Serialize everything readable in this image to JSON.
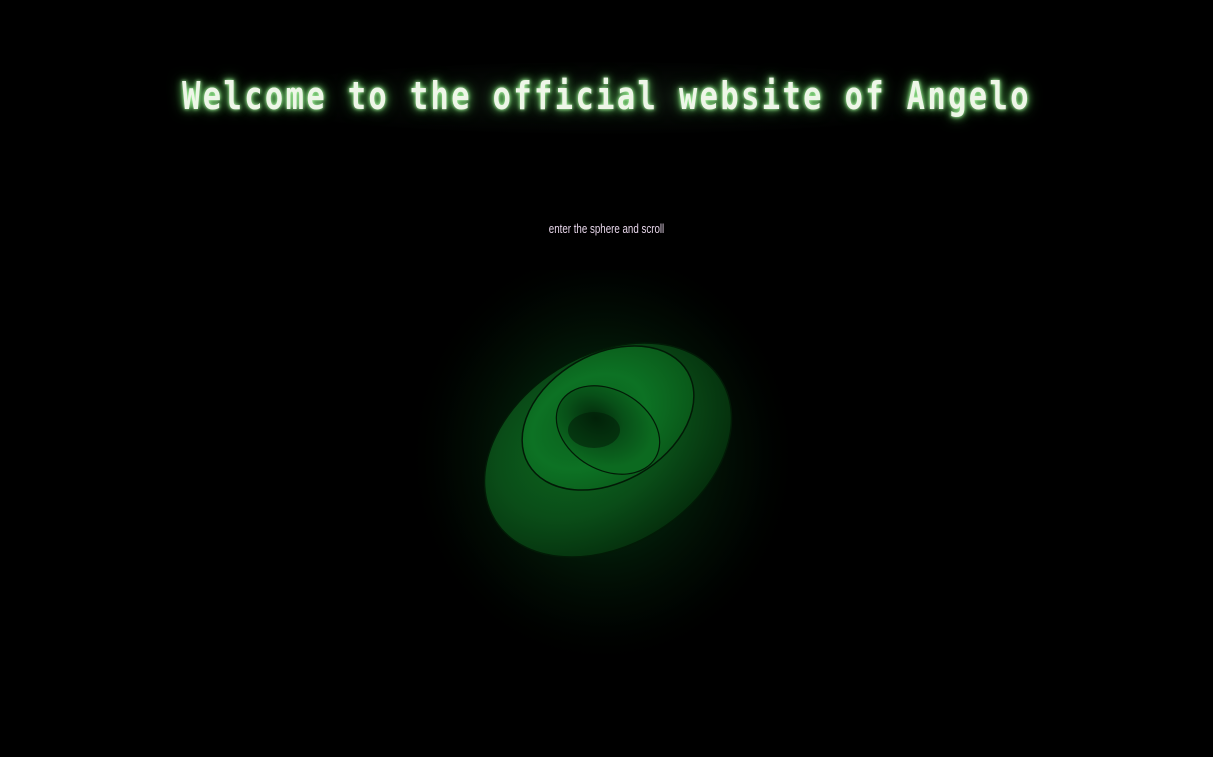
{
  "header": {
    "title": "Welcome to the official website of Angelo"
  },
  "intro": {
    "hint_text": "enter the sphere and scroll"
  },
  "sphere": {
    "icon": "sphere-icon",
    "accent_color": "#0b5a1c"
  },
  "colors": {
    "background": "#000000",
    "title_text": "#eef6e8",
    "title_glow": "#6fd36a",
    "hint_text": "#e7d6ea"
  }
}
